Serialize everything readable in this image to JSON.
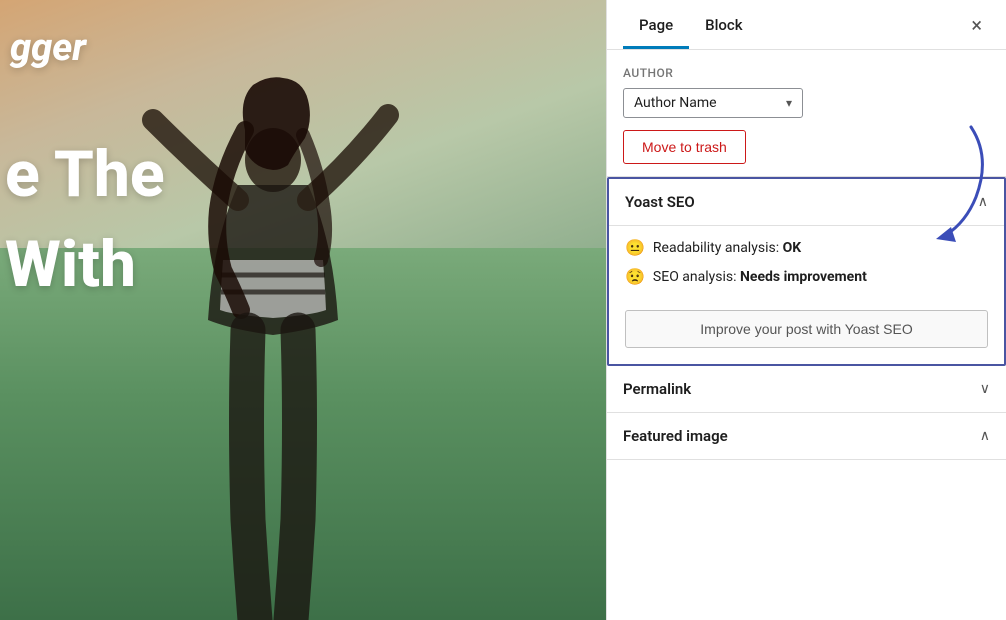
{
  "editor": {
    "bg_text_blogger": "gger",
    "bg_text_line1": "e The",
    "bg_text_line2": "With"
  },
  "sidebar": {
    "tabs": [
      {
        "label": "Page",
        "active": true
      },
      {
        "label": "Block",
        "active": false
      }
    ],
    "close_label": "×",
    "author": {
      "section_label": "Author",
      "dropdown_value": "Author Name",
      "dropdown_arrow": "▾",
      "trash_button_label": "Move to trash"
    },
    "yoast": {
      "title": "Yoast SEO",
      "chevron_open": "∧",
      "readability_icon": "😐",
      "readability_label": "Readability analysis: ",
      "readability_status": "OK",
      "seo_icon": "😟",
      "seo_label": "SEO analysis: ",
      "seo_status": "Needs improvement",
      "improve_button": "Improve your post with Yoast SEO"
    },
    "permalink": {
      "title": "Permalink",
      "chevron": "∨"
    },
    "featured_image": {
      "title": "Featured image",
      "chevron": "∧"
    }
  }
}
